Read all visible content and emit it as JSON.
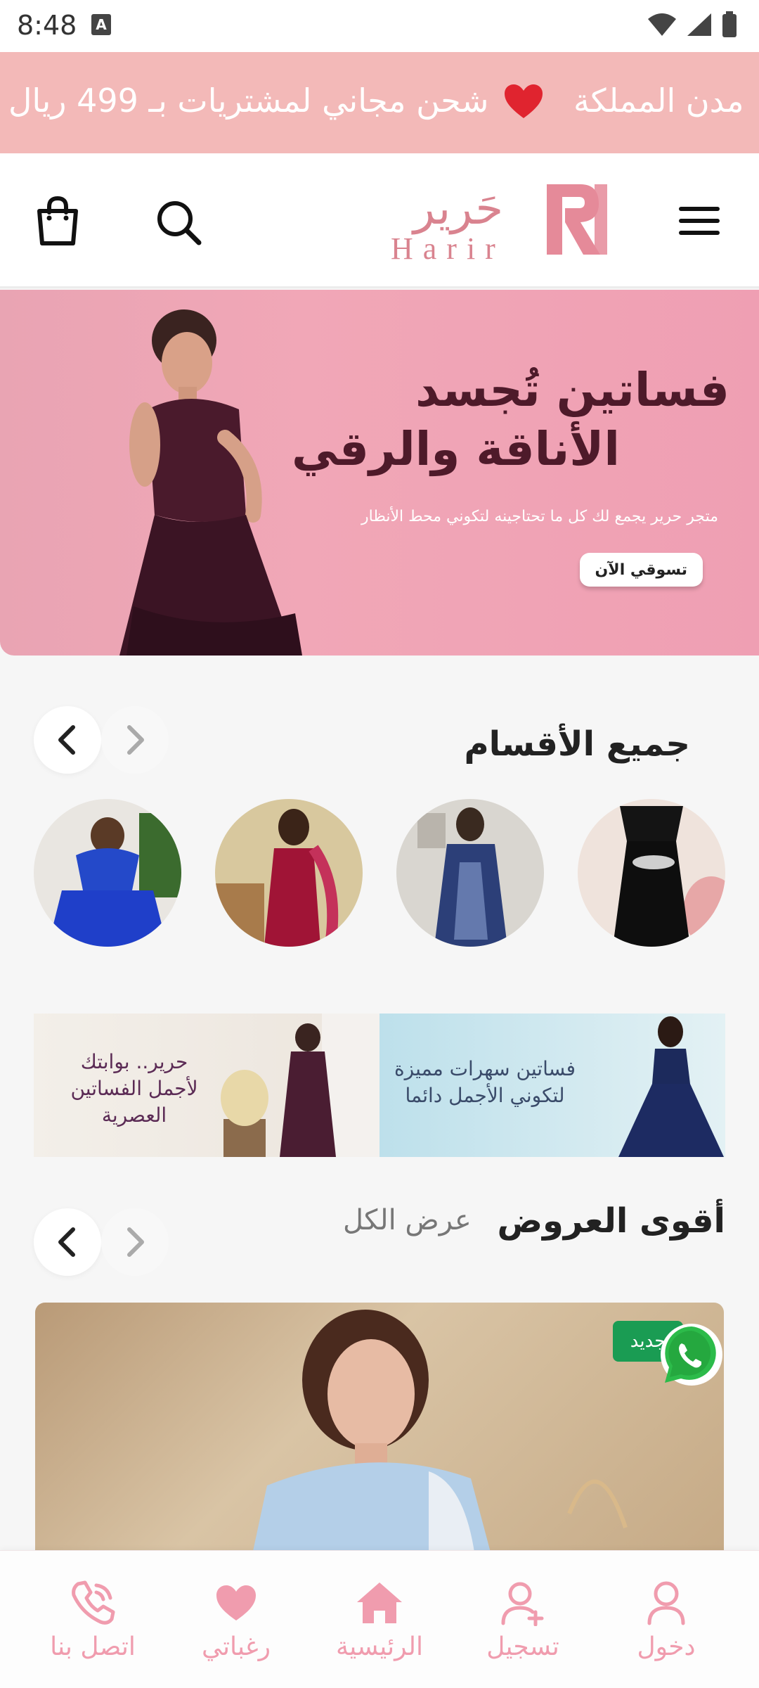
{
  "status_bar": {
    "time": "8:48",
    "notification_letter": "A"
  },
  "promo": {
    "message": "شحن مجاني لمشتريات بـ 499 ريال",
    "message_cut": "مدن المملكة"
  },
  "header": {
    "logo_arabic": "حَرير",
    "logo_latin": "Harir"
  },
  "hero": {
    "title_line1": "فساتين تُجسد",
    "title_line2": "الأناقة والرقي",
    "subtitle": "متجر حرير يجمع لك كل ما تحتاجينه لتكوني محط الأنظار",
    "cta": "تسوقي الآن"
  },
  "categories_section": {
    "title": "جميع الأقسام"
  },
  "mini_banners": {
    "left_line1": "حرير.. بوابتك",
    "left_line2": "لأجمل الفساتين العصرية",
    "right_line1": "فساتين سهرات مميزة",
    "right_line2": "لتكوني الأجمل دائما"
  },
  "offers_section": {
    "title": "أقوى العروض",
    "view_all": "عرض الكل",
    "badge": "جديد"
  },
  "bottom_nav": {
    "contact": "اتصل بنا",
    "wishlist": "رغباتي",
    "home": "الرئيسية",
    "register": "تسجيل",
    "login": "دخول"
  },
  "colors": {
    "brand_pink": "#d9838f",
    "promo_bg": "#f3b9b8",
    "nav_pink": "#f09cae",
    "badge_green": "#1a9c53"
  }
}
